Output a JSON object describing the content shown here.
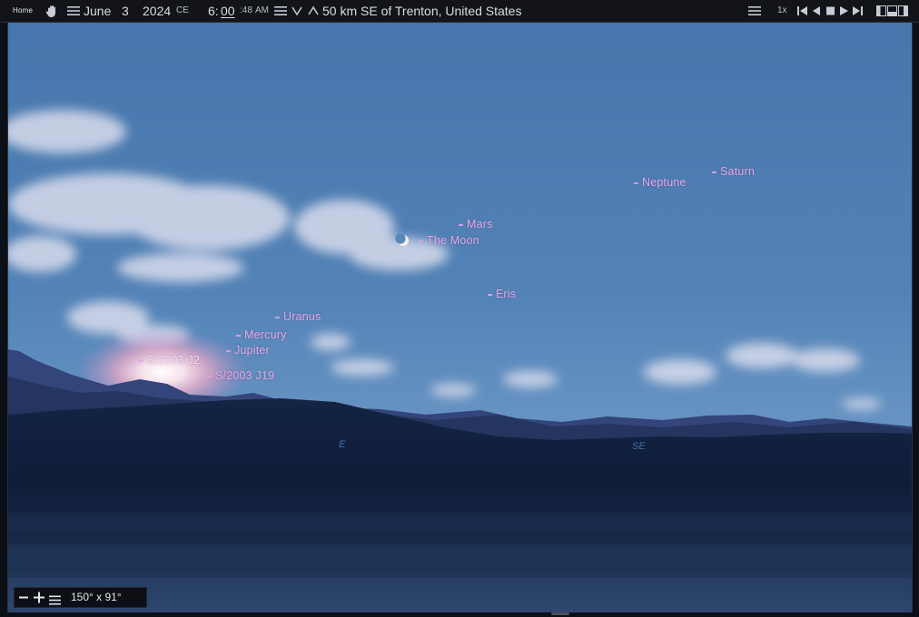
{
  "toolbar": {
    "home_label": "Home",
    "hand_icon": "hand-pan-icon",
    "date": {
      "month": "June",
      "day": "3",
      "year": "2024",
      "era": "CE"
    },
    "time": {
      "hour": "6:",
      "minute": "00",
      "second": ":48",
      "ampm": "AM"
    },
    "location": "50 km SE of Trenton, United States",
    "speed": "1x"
  },
  "sky": {
    "objects": [
      {
        "name": "Saturn"
      },
      {
        "name": "Neptune"
      },
      {
        "name": "Mars"
      },
      {
        "name": "The Moon"
      },
      {
        "name": "Eris"
      },
      {
        "name": "Uranus"
      },
      {
        "name": "Mercury"
      },
      {
        "name": "Jupiter"
      },
      {
        "name": "S/2003 J2"
      },
      {
        "name": "S/2003 J19"
      }
    ],
    "compass": {
      "east": "E",
      "southeast": "SE"
    }
  },
  "fov": {
    "value": "150° x 91°"
  },
  "colors": {
    "sky_top": "#4676ab",
    "sky_horizon": "#7ea6cf",
    "label": "#e6a6e6",
    "ground": "#0f1e3a",
    "toolbar": "#121419"
  }
}
